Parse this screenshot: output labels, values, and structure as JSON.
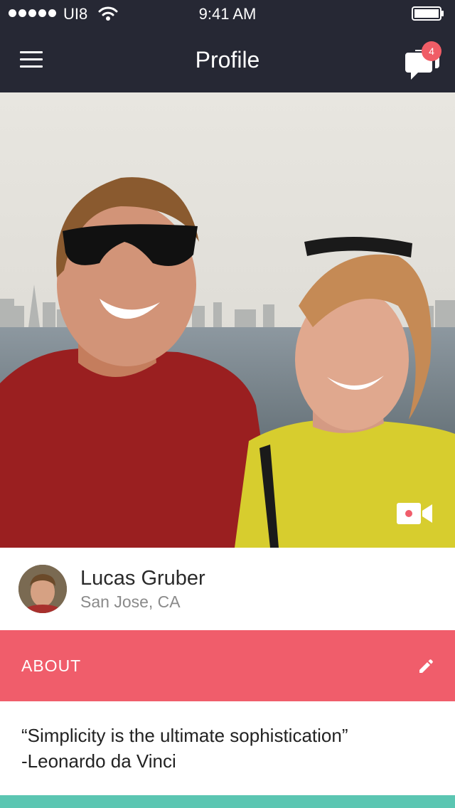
{
  "status_bar": {
    "carrier": "UI8",
    "time": "9:41 AM"
  },
  "nav": {
    "title": "Profile",
    "notification_count": "4"
  },
  "profile": {
    "name": "Lucas Gruber",
    "location": "San Jose, CA"
  },
  "about": {
    "label": "ABOUT",
    "quote": "“Simplicity is the ultimate sophistication”",
    "author": "-Leonardo da Vinci"
  },
  "icons": {
    "menu": "hamburger-icon",
    "messages": "chat-bubbles-icon",
    "video": "video-camera-icon",
    "edit": "pencil-icon"
  },
  "colors": {
    "header_bg": "#262834",
    "badge": "#f05d66",
    "about_bar": "#f05d6b",
    "bottom_strip": "#5bc6b2"
  }
}
